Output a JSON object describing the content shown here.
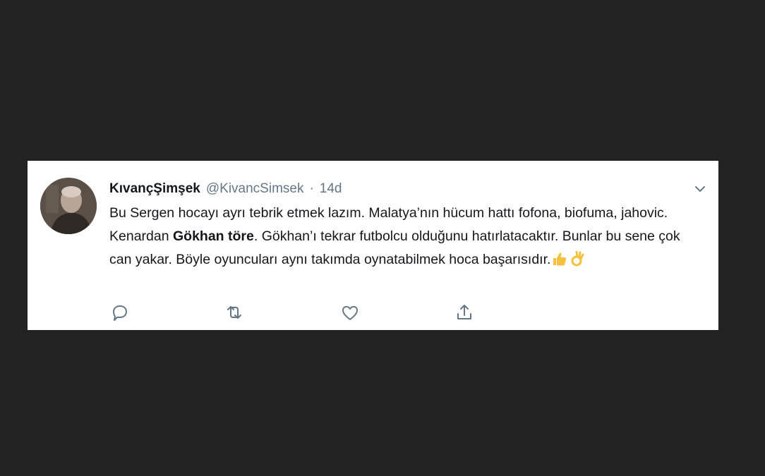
{
  "tweet": {
    "display_name": "KıvançŞimşek",
    "handle": "@KivancSimsek",
    "separator": "·",
    "time": "14d",
    "text_before": "Bu Sergen hocayı ayrı tebrik etmek lazım. Malatya’nın hücum hattı fofona, biofuma, jahovic. Kenardan ",
    "text_bold": "Gökhan töre",
    "text_after": ". Gökhan’ı tekrar futbolcu olduğunu hatırlatacaktır. Bunlar bu sene çok can yakar. Böyle oyuncuları aynı takımda oynatabilmek hoca başarısıdır.",
    "emojis": [
      "thumbs-up-emoji",
      "ok-hand-emoji"
    ]
  },
  "icons": {
    "caret": "chevron-down-icon",
    "reply": "reply-icon",
    "retweet": "retweet-icon",
    "like": "heart-icon",
    "share": "share-icon"
  },
  "colors": {
    "background": "#222222",
    "card": "#ffffff",
    "text": "#14171a",
    "muted": "#657786",
    "emoji": "#f5c03c"
  }
}
